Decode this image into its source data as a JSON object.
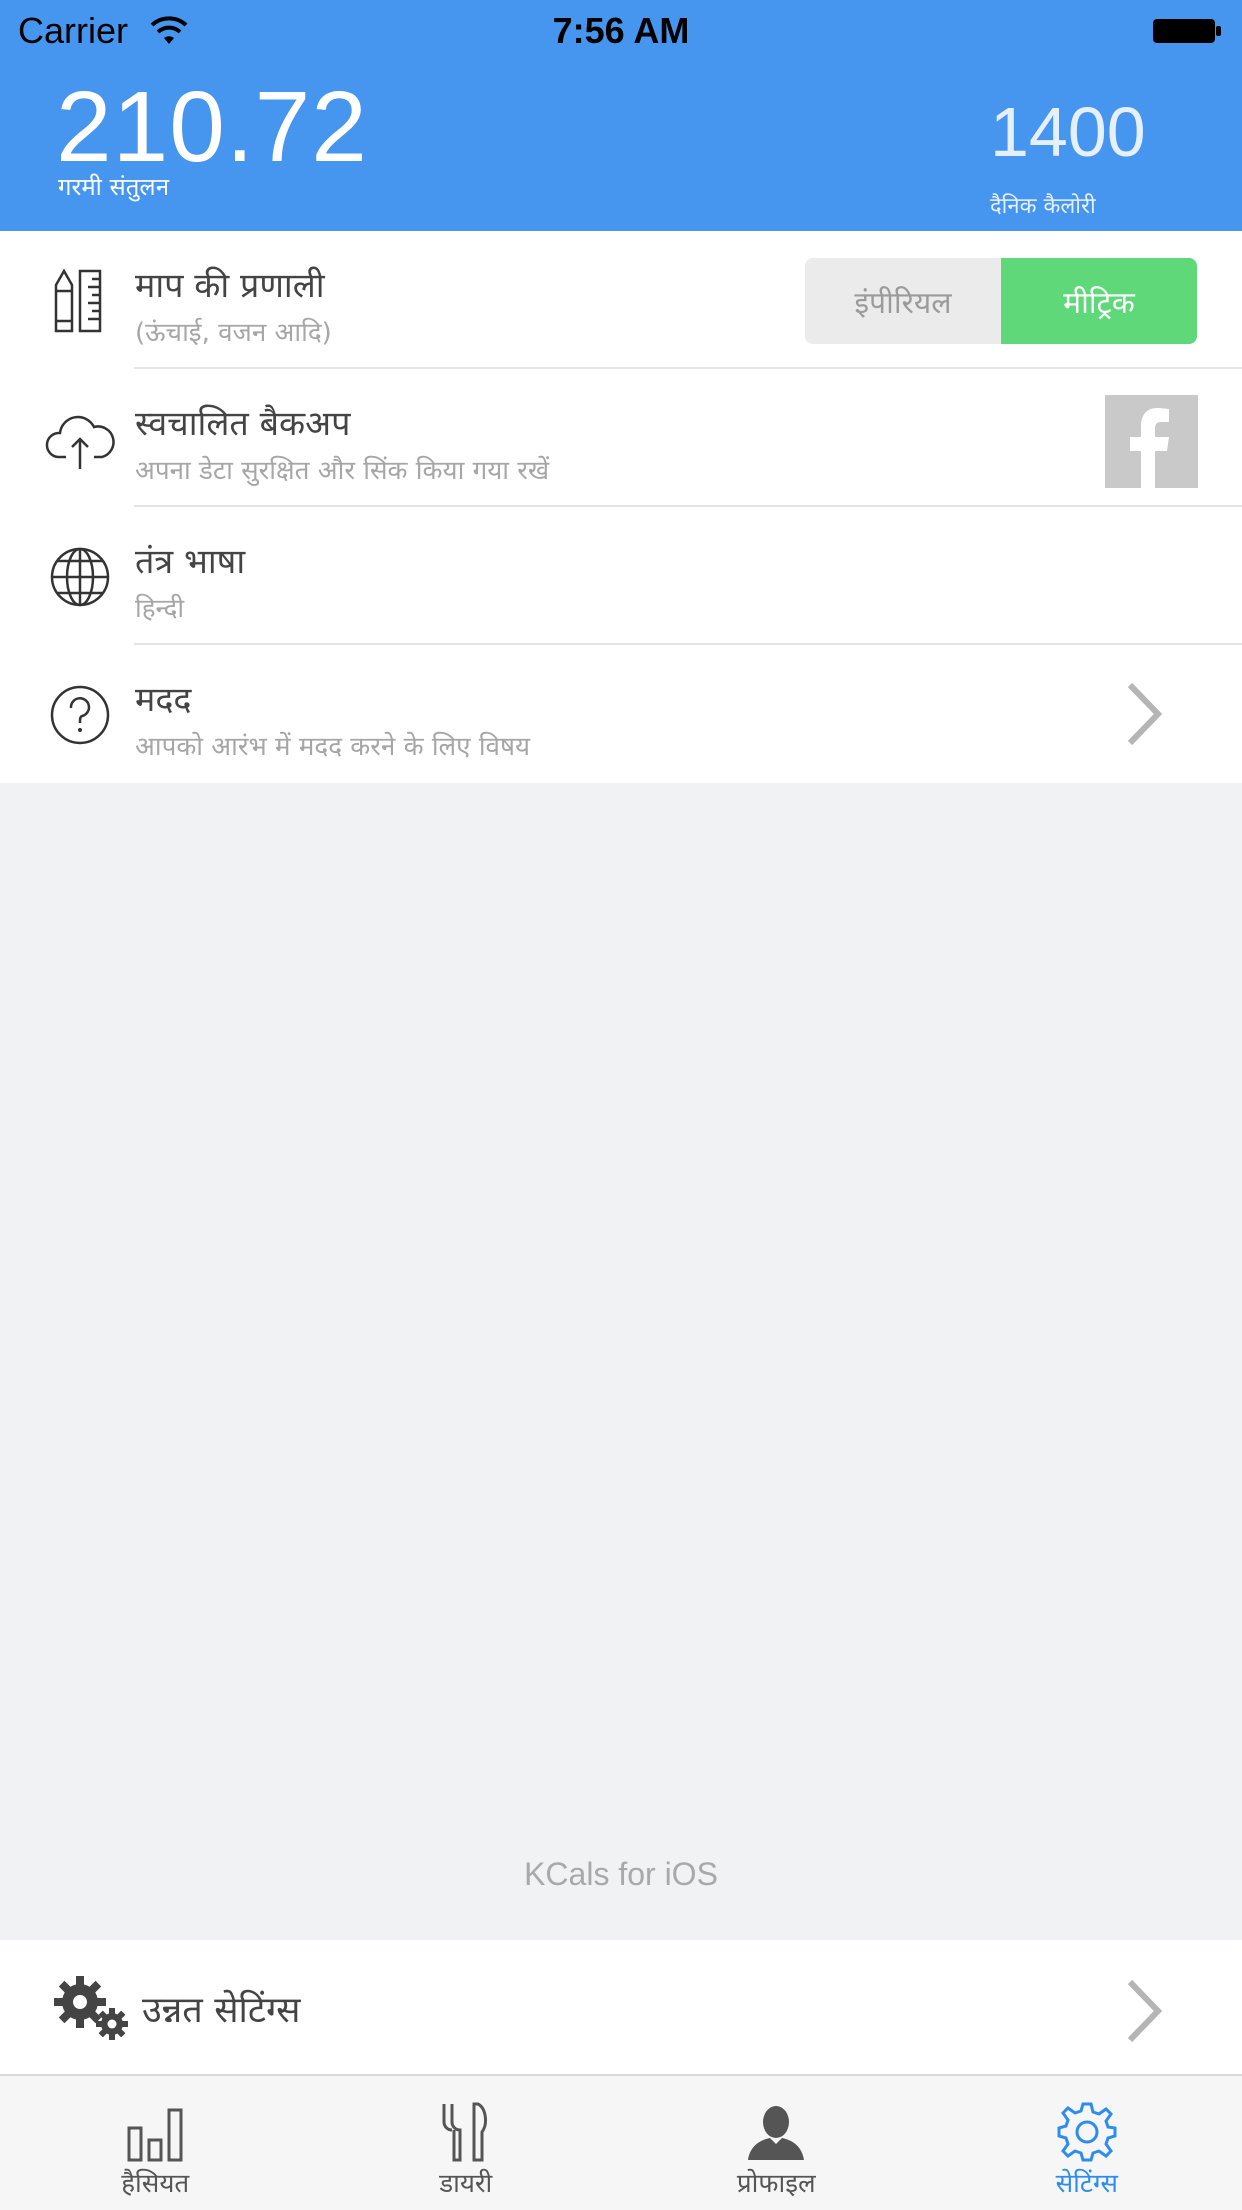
{
  "status_bar": {
    "carrier": "Carrier",
    "time": "7:56 AM"
  },
  "header": {
    "heat_balance_value": "210.72",
    "heat_balance_label": "गरमी संतुलन",
    "daily_calories_value": "1400",
    "daily_calories_label": "दैनिक कैलोरी"
  },
  "settings": {
    "measurement": {
      "title": "माप की प्रणाली",
      "subtitle": "(ऊंचाई, वजन आदि)",
      "options": [
        "इंपीरियल",
        "मीट्रिक"
      ],
      "selected": "मीट्रिक"
    },
    "backup": {
      "title": "स्वचालित बैकअप",
      "subtitle": "अपना डेटा सुरक्षित और सिंक किया गया रखें",
      "icon": "facebook-icon"
    },
    "language": {
      "title": "तंत्र भाषा",
      "subtitle": "हिन्दी"
    },
    "help": {
      "title": "मदद",
      "subtitle": "आपको आरंभ में मदद करने के लिए विषय"
    }
  },
  "footer_note": "KCals for iOS",
  "advanced": {
    "title": "उन्नत सेटिंग्स"
  },
  "tabbar": {
    "tabs": [
      {
        "label": "हैसियत",
        "icon": "bar-chart-icon"
      },
      {
        "label": "डायरी",
        "icon": "fork-knife-icon"
      },
      {
        "label": "प्रोफाइल",
        "icon": "person-icon"
      },
      {
        "label": "सेटिंग्स",
        "icon": "gear-icon"
      }
    ],
    "active": "सेटिंग्स"
  },
  "colors": {
    "header_blue": "#4695ef",
    "metric_green": "#5fd879",
    "active_tab_blue": "#2d8cf0"
  }
}
